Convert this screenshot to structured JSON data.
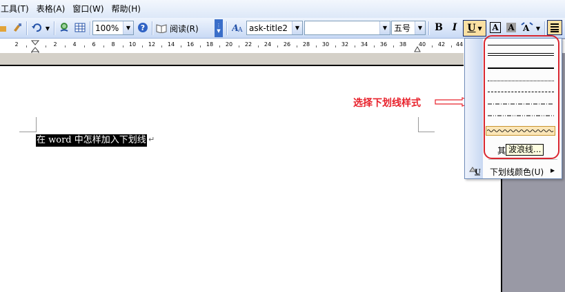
{
  "menubar": {
    "items": [
      "工具(T)",
      "表格(A)",
      "窗口(W)",
      "帮助(H)"
    ]
  },
  "toolbar": {
    "zoom": "100%",
    "reading_label": "阅读(R)",
    "style": "ask-title2",
    "font_name": "",
    "font_size": "五号",
    "bold_label": "B",
    "italic_label": "I",
    "underline_label": "U",
    "font_color_label": "A",
    "char_shading_label": "A"
  },
  "ruler": {
    "numbers": [
      "2",
      "2",
      "4",
      "6",
      "8",
      "10",
      "12",
      "14",
      "16",
      "18",
      "20",
      "22",
      "24",
      "26",
      "28",
      "30",
      "32",
      "34",
      "36",
      "38",
      "40",
      "42",
      "44"
    ]
  },
  "document": {
    "selected_text": "在 word 中怎样加入下划线"
  },
  "annotation": {
    "text": "选择下划线样式"
  },
  "underline_menu": {
    "more_label": "其他",
    "tooltip": "波浪线",
    "color_label": "下划线颜色(U)"
  },
  "colors": {
    "annotation_red": "#e8202a",
    "highlight": "#fbe6b8"
  }
}
